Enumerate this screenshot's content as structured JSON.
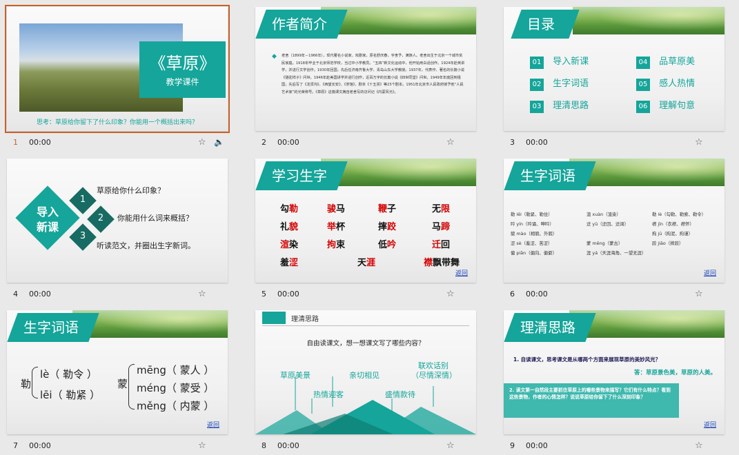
{
  "slides": [
    {
      "num": "1",
      "time": "00:00"
    },
    {
      "num": "2",
      "time": "00:00"
    },
    {
      "num": "3",
      "time": "00:00"
    },
    {
      "num": "4",
      "time": "00:00"
    },
    {
      "num": "5",
      "time": "00:00"
    },
    {
      "num": "6",
      "time": "00:00"
    },
    {
      "num": "7",
      "time": "00:00"
    },
    {
      "num": "8",
      "time": "00:00"
    },
    {
      "num": "9",
      "time": "00:00"
    }
  ],
  "s1": {
    "title": "《草原》",
    "subtitle": "教学课件",
    "question": "思考：草原给你留下了什么印象？你能用一个概括出来吗？"
  },
  "s2": {
    "title": "作者简介",
    "body": "老舍（1899年－1966年），现代著名小说家、戏剧家。原名舒庆春，字舍予，满族人。老舍出生于北京一个城市贫民家庭。1918年毕业于北京师范学校，当过中小学教员。“五四”新文化运动中，他开始用白话创作。1924年赴英讲学，并进行文学创作。1930年回国，先后任济南齐鲁大学、青岛山东大学教授。1937年，代表作、著名的长篇小说《骆驼祥子》问世。1946年赴美国讲学并进行创作，近百万字的长篇小说《四世同堂》问世。1949年年底回到祖国，先后写了《龙须沟》、《西望长安》、《茶馆》、剧本《十五贯》等23个剧本。1951年北京市人民政府授予他“人民艺术家”的光荣称号。《草原》这篇课文摘自老舍写的访问记《内蒙风光》。"
  },
  "s3": {
    "title": "目录",
    "items": [
      {
        "n": "01",
        "label": "导入新课"
      },
      {
        "n": "04",
        "label": "品草原美"
      },
      {
        "n": "02",
        "label": "生字词语"
      },
      {
        "n": "05",
        "label": "感人热情"
      },
      {
        "n": "03",
        "label": "理清思路"
      },
      {
        "n": "06",
        "label": "理解句意"
      }
    ]
  },
  "s4": {
    "badge_line1": "导入",
    "badge_line2": "新课",
    "n1": "1",
    "n2": "2",
    "n3": "3",
    "q1": "草原给你什么印象？",
    "q2": "你能用什么词来概括？",
    "q3": "听读范文，并圈出生字新词。"
  },
  "s5": {
    "title": "学习生字",
    "words": [
      [
        "勾",
        "勒"
      ],
      [
        "",
        "骏",
        "马"
      ],
      [
        "",
        "鞭",
        "子"
      ],
      [
        "无",
        "限"
      ],
      [
        "礼",
        "貌"
      ],
      [
        "",
        "举",
        "杯"
      ],
      [
        "摔",
        "跤"
      ],
      [
        "马",
        "蹄"
      ],
      [
        "渲",
        "染"
      ],
      [
        "",
        "拘",
        "束"
      ],
      [
        "低",
        "吟"
      ],
      [
        "",
        "迁",
        "回"
      ],
      [
        "羞",
        "涩"
      ],
      [
        "天",
        "涯"
      ],
      [
        "",
        "襟",
        "飘带舞"
      ]
    ],
    "back": "返回"
  },
  "s6": {
    "title": "生字词语",
    "lines": [
      "勒 lēi（勒紧、勒住）",
      "渲 xuàn（渲染）",
      "勒 lè（勾勒、勒索、勒令）",
      "吟 yín（吟诵、呻吟）",
      "迂 yū（迂回、迂阔）",
      "襟 jīn（衣襟、襟怀）",
      "貌 mào（相貌、外貌）",
      "拘 jū（拘泥、拘谨）",
      "涩 sè（羞涩、苦涩）",
      "蒙 měng（蒙古）",
      "跤 jiāo（摔跤）",
      "偏 piān（偏向、偏僻）",
      "涯 yá（天涯海角、一望无涯）"
    ],
    "back": "返回"
  },
  "s7": {
    "title": "生字词语",
    "char1": "勒",
    "r1a": "lè（ 勒令 ）",
    "r1b": "lēi（ 勒紧 ）",
    "char2": "蒙",
    "r2a": "mēng（ 蒙人 ）",
    "r2b": "méng（ 蒙受 ）",
    "r2c": "měng（ 内蒙 ）",
    "back": "返回"
  },
  "s8": {
    "title": "理清思路",
    "question": "自由读课文，想一想课文写了哪些内容？",
    "l1": "草原美景",
    "l2": "亲切相见",
    "l3a": "联欢话别",
    "l3b": "（尽情深情）",
    "l4": "热情迎客",
    "l5": "盛情款待"
  },
  "s9": {
    "title": "理清思路",
    "q1": "1. 自读课文，思考课文是从哪两个方面来展现草原的美妙风光？",
    "a1": "答：草原景色美，草原的人美。",
    "q2": "2. 读文第一自然段主要抓住草原上的哪些景物来描写？它们有什么特点？看到这些景物，作者的心情怎样？说说草原给你留下了什么深刻印象？",
    "back": "返回"
  },
  "colors": {
    "teal": "#15a59a",
    "accent": "#c8602a",
    "link": "#1a45b8",
    "red": "#d40000"
  }
}
